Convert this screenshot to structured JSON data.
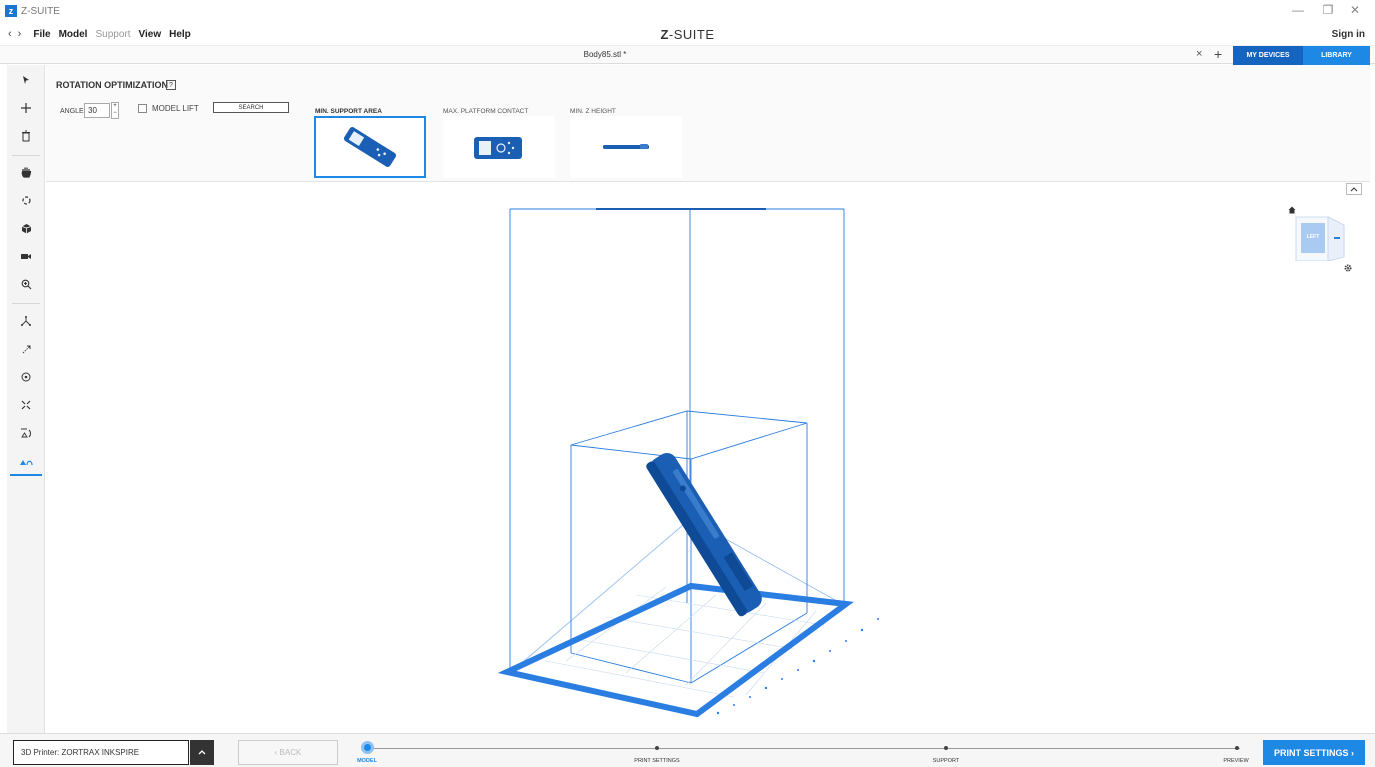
{
  "window": {
    "logo_letter": "z",
    "title": "Z-SUITE",
    "minimize": "—",
    "restore": "❐",
    "close": "✕"
  },
  "menu": {
    "back_arrow": "‹",
    "forward_arrow": "›",
    "items": [
      "File",
      "Model",
      "Support",
      "View",
      "Help"
    ],
    "disabled_items": [
      "Support"
    ],
    "brand_prefix": "Z",
    "brand_suffix": "-SUITE",
    "sign_in": "Sign in"
  },
  "tabs": {
    "file_name": "Body85.stl *",
    "close": "×",
    "add": "+",
    "my_devices": "MY DEVICES",
    "library": "LIBRARY"
  },
  "rotation_panel": {
    "title": "ROTATION OPTIMIZATION",
    "help": "?",
    "angle_label": "ANGLE",
    "angle_value": "30",
    "model_lift_label": "MODEL LIFT",
    "model_lift_checked": false,
    "search_label": "SEARCH",
    "options": [
      {
        "label": "MIN. SUPPORT AREA",
        "selected": true
      },
      {
        "label": "MAX. PLATFORM CONTACT",
        "selected": false
      },
      {
        "label": "MIN. Z HEIGHT",
        "selected": false
      }
    ]
  },
  "view_cube": {
    "face_label": "LEFT"
  },
  "bottom": {
    "printer_label": "3D Printer: ZORTRAX INKSPIRE",
    "back_label": "‹  BACK",
    "steps": [
      "MODEL",
      "PRINT SETTINGS",
      "SUPPORT",
      "PREVIEW"
    ],
    "current_step": "MODEL",
    "next_label": "PRINT SETTINGS  ›"
  },
  "colors": {
    "accent": "#1e88e5",
    "accent_dark": "#1565c0",
    "model": "#1a5fb4"
  }
}
